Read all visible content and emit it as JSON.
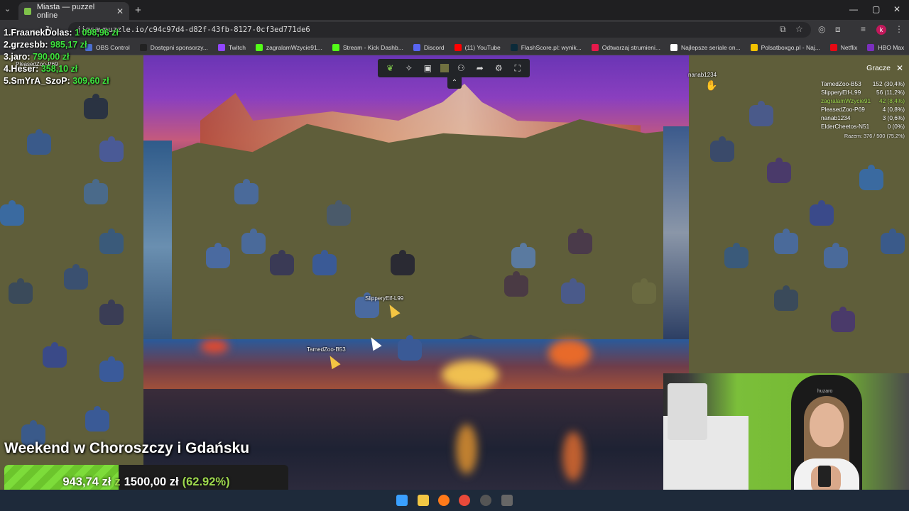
{
  "browser": {
    "tab_title": "Miasta — puzzel online",
    "tab_close": "✕",
    "new_tab": "+",
    "tabs_menu": "⌄",
    "window_controls": [
      "—",
      "▢",
      "✕"
    ],
    "url": "jigsawpuzzle.io/c94c97d4-d82f-43fb-8127-0cf3ed771de6",
    "profile_initial": "k",
    "bookmarks": [
      {
        "label": "OBS Control",
        "color": "#4a6ed0"
      },
      {
        "label": "Dostępni sponsorzy...",
        "color": "#222222"
      },
      {
        "label": "Twitch",
        "color": "#9146ff"
      },
      {
        "label": "zagralamWzycie91...",
        "color": "#53fc18"
      },
      {
        "label": "Stream - Kick Dashb...",
        "color": "#53fc18"
      },
      {
        "label": "Discord",
        "color": "#5865f2"
      },
      {
        "label": "(11) YouTube",
        "color": "#ff0000"
      },
      {
        "label": "FlashScore.pl: wynik...",
        "color": "#0c2b3a"
      },
      {
        "label": "Odtwarzaj strumieni...",
        "color": "#e6194b"
      },
      {
        "label": "Najlepsze seriale on...",
        "color": "#ffffff"
      },
      {
        "label": "Polsatboxgo.pl - Naj...",
        "color": "#f2c200"
      },
      {
        "label": "Netflix",
        "color": "#e50914"
      },
      {
        "label": "HBO Max",
        "color": "#7b2fbe"
      }
    ]
  },
  "leaderboard": [
    {
      "rank_name": "1.FraanekDolas:",
      "amount": "1 098,96 zł"
    },
    {
      "rank_name": "2.grzesbb:",
      "amount": "985,17 zł"
    },
    {
      "rank_name": "3.jaro:",
      "amount": "790,00 zł"
    },
    {
      "rank_name": "4.Heser:",
      "amount": "358,10 zł"
    },
    {
      "rank_name": "5.SmYrA_SzoP:",
      "amount": "309,60 zł"
    }
  ],
  "toolbar": {
    "icons": [
      "leaf-icon",
      "puzzle-edge-icon",
      "box-icon",
      "color-square-icon",
      "players-icon",
      "share-icon",
      "settings-icon",
      "fullscreen-icon"
    ],
    "collapse": "⌃"
  },
  "players_panel": {
    "title": "Gracze",
    "close": "✕",
    "players": [
      {
        "name": "TamedZoo-B53",
        "score": "152 (30,4%)",
        "highlight": false
      },
      {
        "name": "SlipperyElf-L99",
        "score": "56 (11,2%)",
        "highlight": false
      },
      {
        "name": "zagralamWzycie91",
        "score": "42 (8,4%)",
        "highlight": true
      },
      {
        "name": "PleasedZoo-P69",
        "score": "4 (0,8%)",
        "highlight": false
      },
      {
        "name": "nanab1234",
        "score": "3 (0,6%)",
        "highlight": false
      },
      {
        "name": "ElderCheetos-N51",
        "score": "0 (0%)",
        "highlight": false
      }
    ],
    "total": "Razem: 376 / 500 (75,2%)"
  },
  "cursors": {
    "slippery": "SlipperyElf-L99",
    "tamed": "TamedZoo-B53",
    "nanab": "nanab1234",
    "pleased": "PleasedZoo-P69"
  },
  "goal": {
    "title": "Weekend w Choroszczy i Gdańsku",
    "current": "943,74 zł",
    "separator": "z",
    "target": "1500,00 zł",
    "percent_text": "(62.92%)",
    "progress": 0.6292
  },
  "webcam": {
    "chair_brand": "huzaro"
  }
}
